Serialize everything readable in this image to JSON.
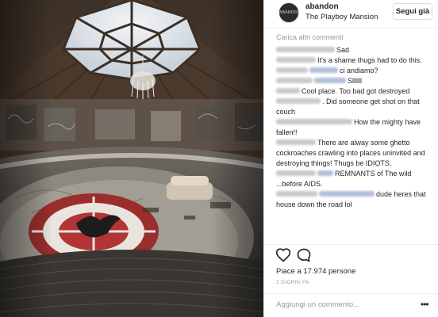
{
  "post": {
    "image_alt": "The Playboy Mansion",
    "username": "abandon",
    "location": "The Playboy Mansion",
    "follow_label": "Segui già",
    "avatar_text": "ABANDON"
  },
  "comments": {
    "load_more": "Carica altri commenti",
    "items": [
      {
        "name_w": 74,
        "text": "Sad"
      },
      {
        "name_w": 50,
        "text": "It's a shame thugs had to do this."
      },
      {
        "name_w": 40,
        "tag_w": 36,
        "text": "ci andiamo?"
      },
      {
        "name_w": 46,
        "text": "Sllllll",
        "tag_w": 40
      },
      {
        "name_w": 30,
        "text": "Cool place. Too bad got destroyed"
      },
      {
        "name_w": 56,
        "text": ". Did someone get shot on that couch"
      },
      {
        "name_w": 96,
        "text": "How the mighty have fallen!!"
      },
      {
        "name_w": 50,
        "text": "There are alway some ghetto cockroaches crawling into places uninvited and destroying things! Thugs be IDIOTS."
      },
      {
        "name_w": 50,
        "text": "REMNANTS of The wild ...before AIDS.",
        "tag_w": 20
      },
      {
        "name_w": 52,
        "tag_w": 70,
        "text": "dude heres that house down the road lol"
      }
    ]
  },
  "actions": {
    "like_icon": "heart-icon",
    "comment_icon": "comment-bubble-icon",
    "likes_text": "Piace a 17.974 persone",
    "timestamp": "2 GIORNI FA"
  },
  "add_comment": {
    "placeholder": "Aggiungi un commento...",
    "more_label": "•••"
  }
}
